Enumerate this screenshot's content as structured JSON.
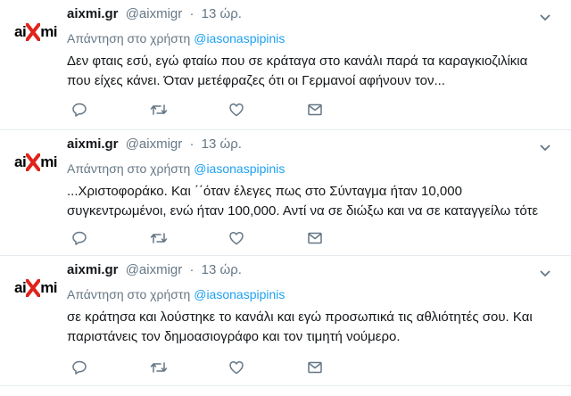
{
  "tweets": [
    {
      "avatar": {
        "left": "ai",
        "mid": "X",
        "right": "mi"
      },
      "name": "aixmi.gr",
      "handle": "@aixmigr",
      "dot": "·",
      "time": "13 ώρ.",
      "reply_prefix": "Απάντηση στο χρήστη",
      "mention": "@iasonaspipinis",
      "lines": [
        "Δεν φταις εσύ, εγώ φταίω που σε κράταγα στο κανάλι παρά τα καραγκιοζιλίκια",
        "που είχες κάνει. Όταν μετέφραζες ότι οι Γερμανοί αφήνουν τον..."
      ]
    },
    {
      "avatar": {
        "left": "ai",
        "mid": "X",
        "right": "mi"
      },
      "name": "aixmi.gr",
      "handle": "@aixmigr",
      "dot": "·",
      "time": "13 ώρ.",
      "reply_prefix": "Απάντηση στο χρήστη",
      "mention": "@iasonaspipinis",
      "lines": [
        "...Χριστοφοράκο. Και ΄΄όταν έλεγες πως στο Σύνταγμα ήταν 10,000",
        "συγκεντρωμένοι, ενώ ήταν 100,000. Αντί να σε διώξω και να σε καταγγείλω τότε"
      ]
    },
    {
      "avatar": {
        "left": "ai",
        "mid": "X",
        "right": "mi"
      },
      "name": "aixmi.gr",
      "handle": "@aixmigr",
      "dot": "·",
      "time": "13 ώρ.",
      "reply_prefix": "Απάντηση στο χρήστη",
      "mention": "@iasonaspipinis",
      "lines": [
        "σε κράτησα και λούστηκε το κανάλι και εγώ προσωπικά τις αθλιότητές σου. Και",
        "παριστάνεις τον δημοασιογράφο και τον τιμητή νούμερο."
      ]
    }
  ],
  "icons": {
    "reply": "reply-icon",
    "retweet": "retweet-icon",
    "like": "heart-icon",
    "dm": "envelope-icon",
    "caret": "chevron-down-icon"
  },
  "colors": {
    "text": "#14171a",
    "muted": "#657786",
    "link": "#1da1f2",
    "logo_x": "#e0241b",
    "divider": "#e6ecf0"
  }
}
